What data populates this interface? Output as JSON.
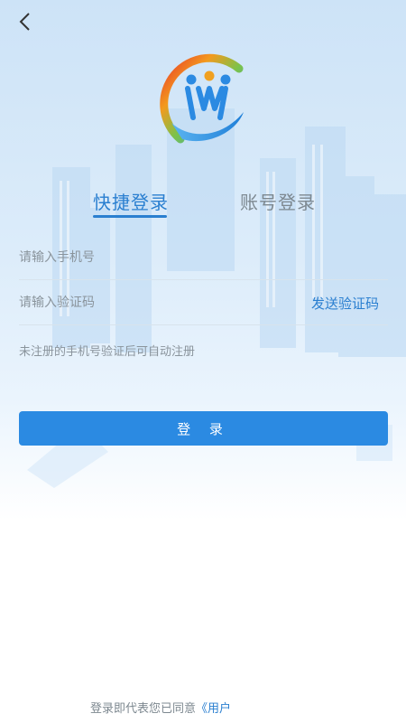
{
  "nav": {
    "back_icon": "chevron-left-icon"
  },
  "logo": {
    "icon": "people-hand-logo-icon"
  },
  "tabs": [
    {
      "label": "快捷登录",
      "active": true
    },
    {
      "label": "账号登录",
      "active": false
    }
  ],
  "form": {
    "phone": {
      "placeholder": "请输入手机号",
      "value": ""
    },
    "code": {
      "placeholder": "请输入验证码",
      "value": ""
    },
    "send_code_label": "发送验证码",
    "hint": "未注册的手机号验证后可自动注册",
    "login_label": "登 录"
  },
  "agreement": {
    "prefix": "登录即代表您已同意",
    "link": "《用户"
  },
  "colors": {
    "accent": "#2a7fd0",
    "button": "#2b8ae2",
    "muted": "#8a949c"
  }
}
